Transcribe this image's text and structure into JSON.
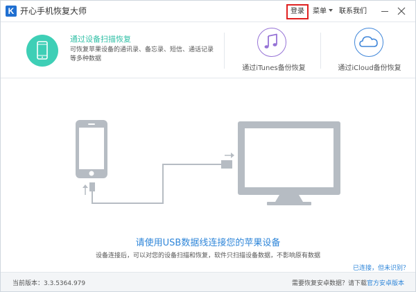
{
  "window": {
    "logo_letter": "K",
    "title": "开心手机恢复大师",
    "login_label": "登录",
    "menu_label": "菜单",
    "contact_label": "联系我们"
  },
  "modes": {
    "device": {
      "title": "通过设备扫描恢复",
      "description": "可恢复苹果设备的通讯录、备忘录、短信、通话记录等多种数据",
      "icon": "phone-icon",
      "color": "#3ecfb6"
    },
    "itunes": {
      "label": "通过iTunes备份恢复",
      "icon": "music-note-icon",
      "color": "#9673d6"
    },
    "icloud": {
      "label": "通过iCloud备份恢复",
      "icon": "cloud-icon",
      "color": "#3f86d9"
    }
  },
  "main": {
    "title": "请使用USB数据线连接您的苹果设备",
    "description": "设备连接后，可以对您的设备扫描和恢复，软件只扫描设备数据，不影响原有数据",
    "not_detected_link": "已连接，但未识别？"
  },
  "statusbar": {
    "version_label": "当前版本：",
    "version": "3.3.5364.979",
    "android_question": "需要恢复安卓数据？请下载",
    "android_link": "官方安卓版本"
  },
  "colors": {
    "accent_blue": "#2f86d9",
    "accent_teal": "#3ecfb6",
    "highlight_red": "#e02020",
    "illustration_gray": "#b6bcc3"
  }
}
